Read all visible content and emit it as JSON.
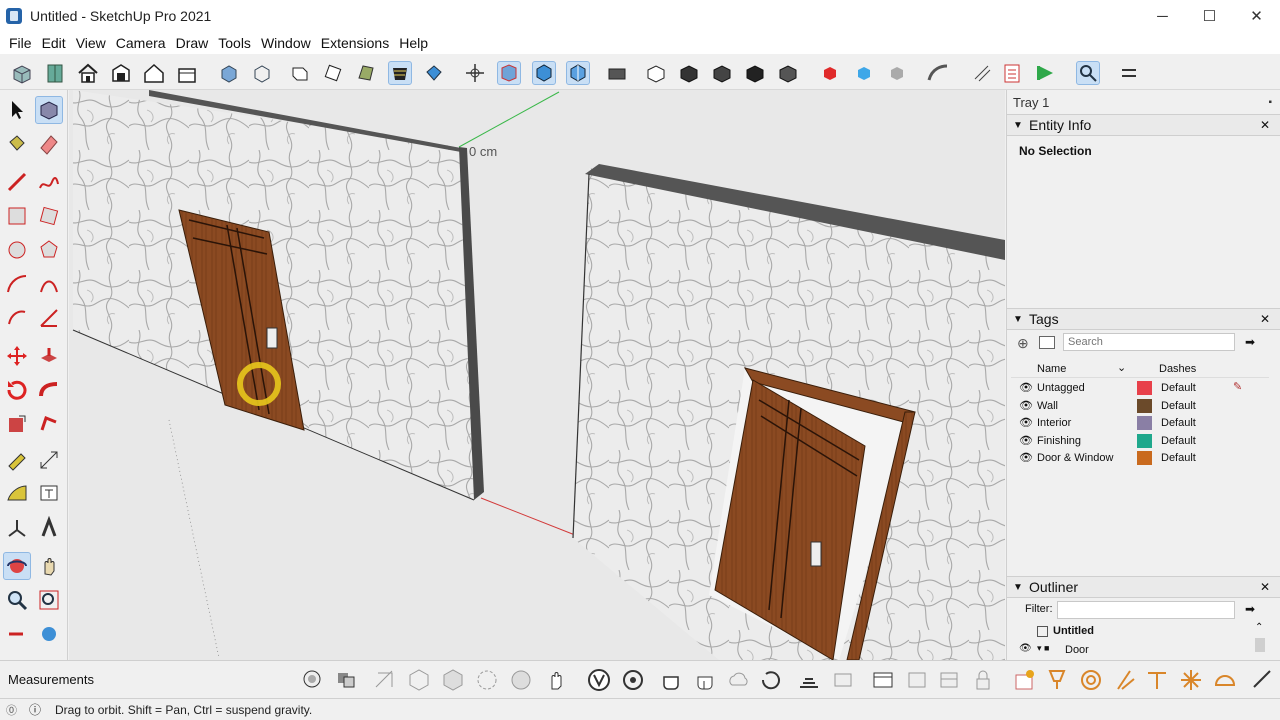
{
  "window": {
    "title": "Untitled - SketchUp Pro 2021",
    "minimize": "─",
    "maximize": "☐",
    "close": "✕"
  },
  "menu": [
    "File",
    "Edit",
    "View",
    "Camera",
    "Draw",
    "Tools",
    "Window",
    "Extensions",
    "Help"
  ],
  "viewport": {
    "dimension_label": "0 cm"
  },
  "tray": {
    "title": "Tray 1",
    "entity_info": {
      "title": "Entity Info",
      "status": "No Selection"
    },
    "tags": {
      "title": "Tags",
      "search_placeholder": "Search",
      "col_name": "Name",
      "col_dashes": "Dashes",
      "rows": [
        {
          "name": "Untagged",
          "color": "#e8404a",
          "dashes": "Default"
        },
        {
          "name": "Wall",
          "color": "#6b4a2a",
          "dashes": "Default"
        },
        {
          "name": "Interior",
          "color": "#8a7fa5",
          "dashes": "Default"
        },
        {
          "name": "Finishing",
          "color": "#1fa88c",
          "dashes": "Default"
        },
        {
          "name": "Door & Window",
          "color": "#c96a1e",
          "dashes": "Default"
        }
      ]
    },
    "outliner": {
      "title": "Outliner",
      "filter_label": "Filter:",
      "root": "Untitled",
      "child": "Door"
    }
  },
  "measurements": {
    "label": "Measurements"
  },
  "status": {
    "text": "Drag to orbit. Shift = Pan, Ctrl = suspend gravity."
  }
}
